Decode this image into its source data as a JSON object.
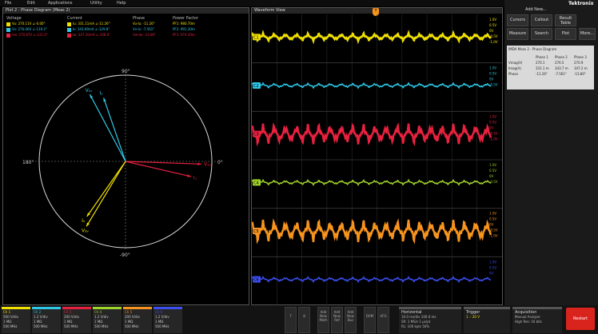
{
  "menu": [
    "File",
    "Edit",
    "Applications",
    "Utility",
    "Help"
  ],
  "phase_panel": {
    "title": "Plot 2 - Phase Diagram (Meas 2)",
    "columns": [
      "Voltage",
      "Current",
      "Phase",
      "Power Factor"
    ],
    "rows": [
      {
        "color": "#f0e000",
        "voltage": "Vu: 270.11V ∠-0.00°",
        "current": "Iu: 331.11mA ∠-11.26°",
        "phase": "Vu-Iu: -11.26°",
        "pf": "PF1: 980.70m"
      },
      {
        "color": "#2ec7e6",
        "voltage": "Vv: 276.46V ∠-119.2°",
        "current": "Iv: 343.69mA ∠-129.8°",
        "phase": "Vv-Iv: -7.561°",
        "pf": "PF2: 991.30m"
      },
      {
        "color": "#e8213f",
        "voltage": "Vw: 270.87V ∠-121.0°",
        "current": "Iw: 347.20mA ∠-108.6°",
        "phase": "Vw-Iw: -13.80°",
        "pf": "PF3: 974.20m"
      }
    ],
    "axis": {
      "top": "90°",
      "bottom": "-90°",
      "left": "180°",
      "right": "0°"
    },
    "vectors": [
      {
        "label": "V₁ᵤ",
        "color": "#e8213f",
        "angle": -2
      },
      {
        "label": "Iᵤ",
        "color": "#e8213f",
        "angle": -13
      },
      {
        "label": "V₂ᵥ",
        "color": "#2ec7e6",
        "angle": 118
      },
      {
        "label": "Iᵥ",
        "color": "#2ec7e6",
        "angle": 109
      },
      {
        "label": "V₃ᵥ",
        "color": "#f0e000",
        "angle": -121
      },
      {
        "label": "Iᵥ",
        "color": "#f0e000",
        "angle": -125
      }
    ]
  },
  "wave_panel": {
    "title": "Waveform View",
    "channels": [
      {
        "label": "C1",
        "color": "#f0e000",
        "scale": [
          "1.0V",
          "0.5V",
          "0V",
          "-0.5V",
          "-1.0V"
        ]
      },
      {
        "label": "C2",
        "color": "#2ec7e6",
        "scale": [
          "1.0V",
          "0.5V",
          "0V",
          "-0.5V"
        ]
      },
      {
        "label": "C3",
        "color": "#e8213f",
        "scale": [
          "1.0V",
          "0.5V",
          "0V",
          "-0.5V",
          "-1.0V"
        ]
      },
      {
        "label": "C4",
        "color": "#9fd42a",
        "scale": [
          "1.0V",
          "0.5V",
          "0V",
          "-0.5V"
        ]
      },
      {
        "label": "C5",
        "color": "#f7941d",
        "scale": [
          "1.0V",
          "0.5V",
          "0V",
          "-0.5V",
          "-1.0V"
        ]
      },
      {
        "label": "C6",
        "color": "#3c4ff0",
        "scale": [
          "1.0V",
          "0.5V",
          "0V"
        ]
      }
    ]
  },
  "right_panel": {
    "add_new": "Add New...",
    "brand": "Tektronix",
    "buttons": [
      {
        "name": "cursors",
        "label": "Cursors"
      },
      {
        "name": "callout",
        "label": "Callout"
      },
      {
        "name": "results-table",
        "label": "Result Table"
      },
      {
        "name": "measure",
        "label": "Measure"
      },
      {
        "name": "search",
        "label": "Search"
      },
      {
        "name": "plot",
        "label": "Plot"
      },
      {
        "name": "more",
        "label": "More..."
      }
    ],
    "badge": {
      "title": "IMDA Meas 2 - Phase Diagram",
      "headers": [
        "Phase 1",
        "Phase 2",
        "Phase 3"
      ],
      "rows": [
        {
          "label": "Vmag(V)",
          "values": [
            "270.1",
            "276.5",
            "270.9"
          ]
        },
        {
          "label": "Imag(A)",
          "values": [
            "331.1 m",
            "343.7 m",
            "347.2 m"
          ]
        },
        {
          "label": "Phase",
          "values": [
            "-11.26°",
            "-7.561°",
            "-13.80°"
          ]
        }
      ]
    }
  },
  "bottom": {
    "channels": [
      {
        "label": "Ch 1",
        "color": "#f0e000",
        "l1": "500 V/div",
        "l2": "1 MΩ",
        "l3": "500 MHz"
      },
      {
        "label": "Ch 2",
        "color": "#2ec7e6",
        "l1": "1.2 V/div",
        "l2": "1 MΩ",
        "l3": "500 MHz"
      },
      {
        "label": "Ch 3",
        "color": "#e8213f",
        "l1": "200 V/div",
        "l2": "1 MΩ",
        "l3": "500 MHz"
      },
      {
        "label": "Ch 4",
        "color": "#9fd42a",
        "l1": "1.2 V/div",
        "l2": "1 MΩ",
        "l3": "500 MHz"
      },
      {
        "label": "Ch 5",
        "color": "#f7941d",
        "l1": "200 V/div",
        "l2": "1 MΩ",
        "l3": "500 MHz"
      },
      {
        "label": "Ch 6",
        "color": "#3c4ff0",
        "l1": "1.2 V/div",
        "l2": "1 MΩ",
        "l3": "500 MHz"
      }
    ],
    "buttons": [
      "7",
      "8",
      "Add New Math",
      "Add New Ref",
      "Add New Bus",
      "DVM",
      "AFG"
    ],
    "horizontal": {
      "title": "Horizontal",
      "l1": "10.0 ms/div  100.0 ms",
      "l2": "SR: 1 MS/s   1 µs/pt",
      "l3": "RL: 100 kpts   50%"
    },
    "trigger": {
      "title": "Trigger",
      "l1": "1   ⟋  20 V"
    },
    "acquisition": {
      "title": "Acquisition",
      "l1": "Manual   Analyze",
      "l2": "High Res: 16 bits"
    },
    "stop_label": "Restart"
  }
}
